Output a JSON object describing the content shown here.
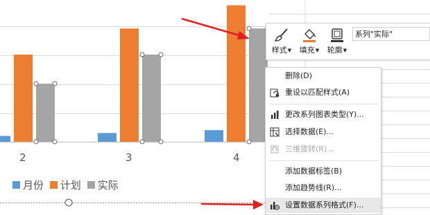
{
  "chart_data": {
    "type": "bar",
    "categories": [
      "2",
      "3",
      "4"
    ],
    "series": [
      {
        "name": "月份",
        "values": [
          2,
          3,
          4
        ]
      },
      {
        "name": "计划",
        "values": [
          30,
          39,
          47
        ]
      },
      {
        "name": "实际",
        "values": [
          20,
          30,
          39
        ]
      }
    ],
    "title": "",
    "xlabel": "",
    "ylabel": ""
  },
  "colors": {
    "series1": "#5b9bd5",
    "series2": "#ed7d31",
    "series3": "#a5a5a5",
    "arrow": "#e02020"
  },
  "toolbar": {
    "style_label": "样式",
    "fill_label": "填充",
    "outline_label": "轮廓",
    "series_value": "系列\"实际\""
  },
  "menu": {
    "delete": "删除(D)",
    "reset_style": "重设以匹配样式(A)",
    "change_type": "更改系列图表类型(Y)...",
    "select_data": "选择数据(E)...",
    "rotate_3d": "三维旋转(R)...",
    "add_labels": "添加数据标签(B)",
    "add_trendline": "添加趋势线(R)...",
    "format_series": "设置数据系列格式(F)..."
  }
}
